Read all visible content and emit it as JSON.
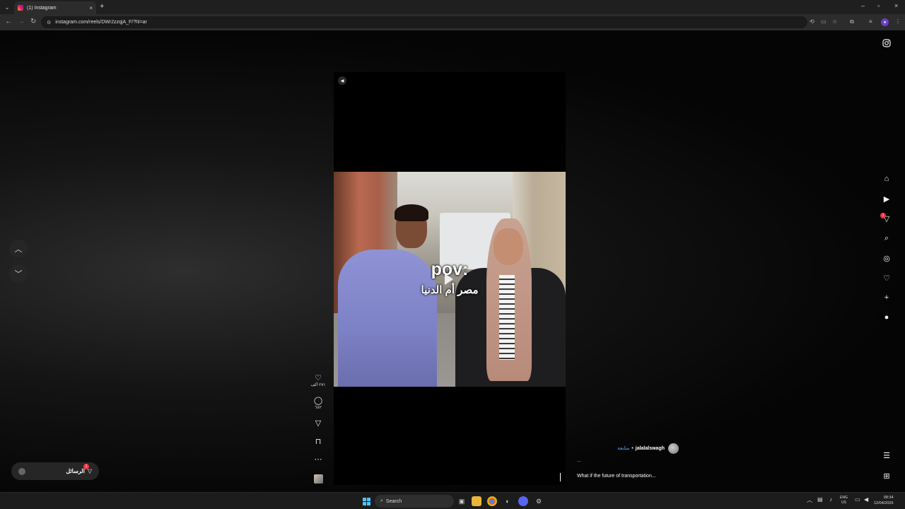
{
  "browser": {
    "tab_title": "(1) Instagram",
    "tab_close": "×",
    "new_tab": "+",
    "url": "instagram.com/reels/DWr2zzqjA_F/?hl=ar",
    "menu_icon": "chevron-down-icon",
    "window_controls": {
      "minimize": "–",
      "maximize": "▫",
      "close": "×"
    }
  },
  "reel": {
    "overlay_text_en": "pov:",
    "overlay_text_ar": "مصر أم الدنيا",
    "likes": "٢٧١ ألف",
    "comments": "٦٨٢"
  },
  "author": {
    "follow_label": "متابعة",
    "separator": "•",
    "username": "jalalalswagh"
  },
  "caption": {
    "dots": "...",
    "text": "What if the future of transportation..."
  },
  "messages": {
    "label": "الرسائل",
    "badge": "1"
  },
  "side_nav": {
    "notifications_badge": "1"
  },
  "taskbar": {
    "search_label": "Search",
    "lang_line1": "ENG",
    "lang_line2": "US",
    "time": "08:34",
    "date": "12/04/2026"
  }
}
